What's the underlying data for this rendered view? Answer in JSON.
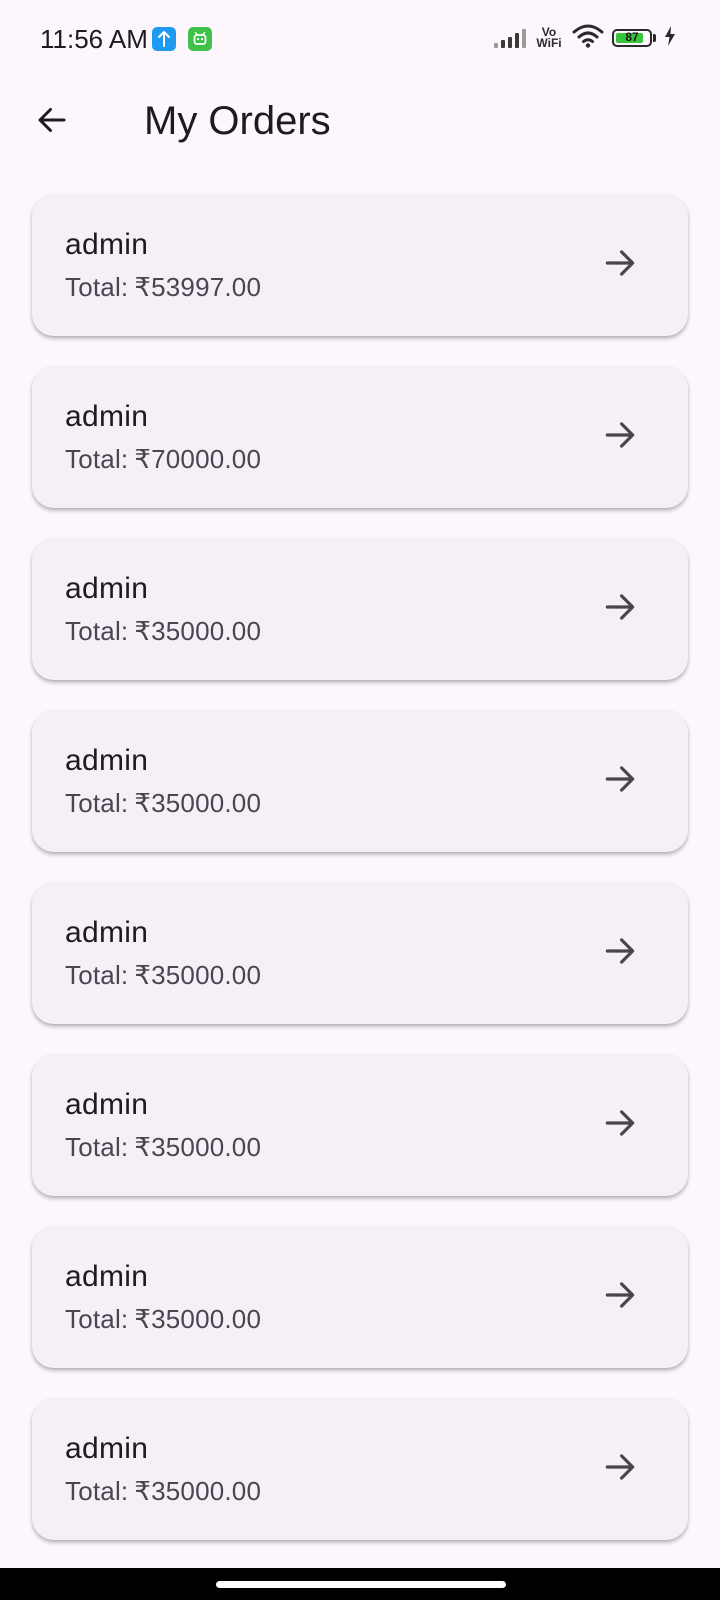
{
  "status_bar": {
    "time": "11:56 AM",
    "notification_icons": [
      "upload-arrow-icon",
      "android-robot-icon"
    ],
    "vowifi_top": "Vo",
    "vowifi_bottom": "WiFi",
    "battery_percent": "87",
    "battery_level": 0.87,
    "charging": true
  },
  "app_bar": {
    "back_icon": "arrow-back-icon",
    "title": "My Orders"
  },
  "orders": [
    {
      "name": "admin",
      "total_label": "Total:",
      "total_value": "₹53997.00"
    },
    {
      "name": "admin",
      "total_label": "Total:",
      "total_value": "₹70000.00"
    },
    {
      "name": "admin",
      "total_label": "Total:",
      "total_value": "₹35000.00"
    },
    {
      "name": "admin",
      "total_label": "Total:",
      "total_value": "₹35000.00"
    },
    {
      "name": "admin",
      "total_label": "Total:",
      "total_value": "₹35000.00"
    },
    {
      "name": "admin",
      "total_label": "Total:",
      "total_value": "₹35000.00"
    },
    {
      "name": "admin",
      "total_label": "Total:",
      "total_value": "₹35000.00"
    },
    {
      "name": "admin",
      "total_label": "Total:",
      "total_value": "₹35000.00"
    }
  ],
  "colors": {
    "background": "#fdf7fd",
    "card": "#f6eff6",
    "text_primary": "#1d1b20",
    "text_secondary": "#4a4552",
    "battery_fill": "#39c53b"
  }
}
